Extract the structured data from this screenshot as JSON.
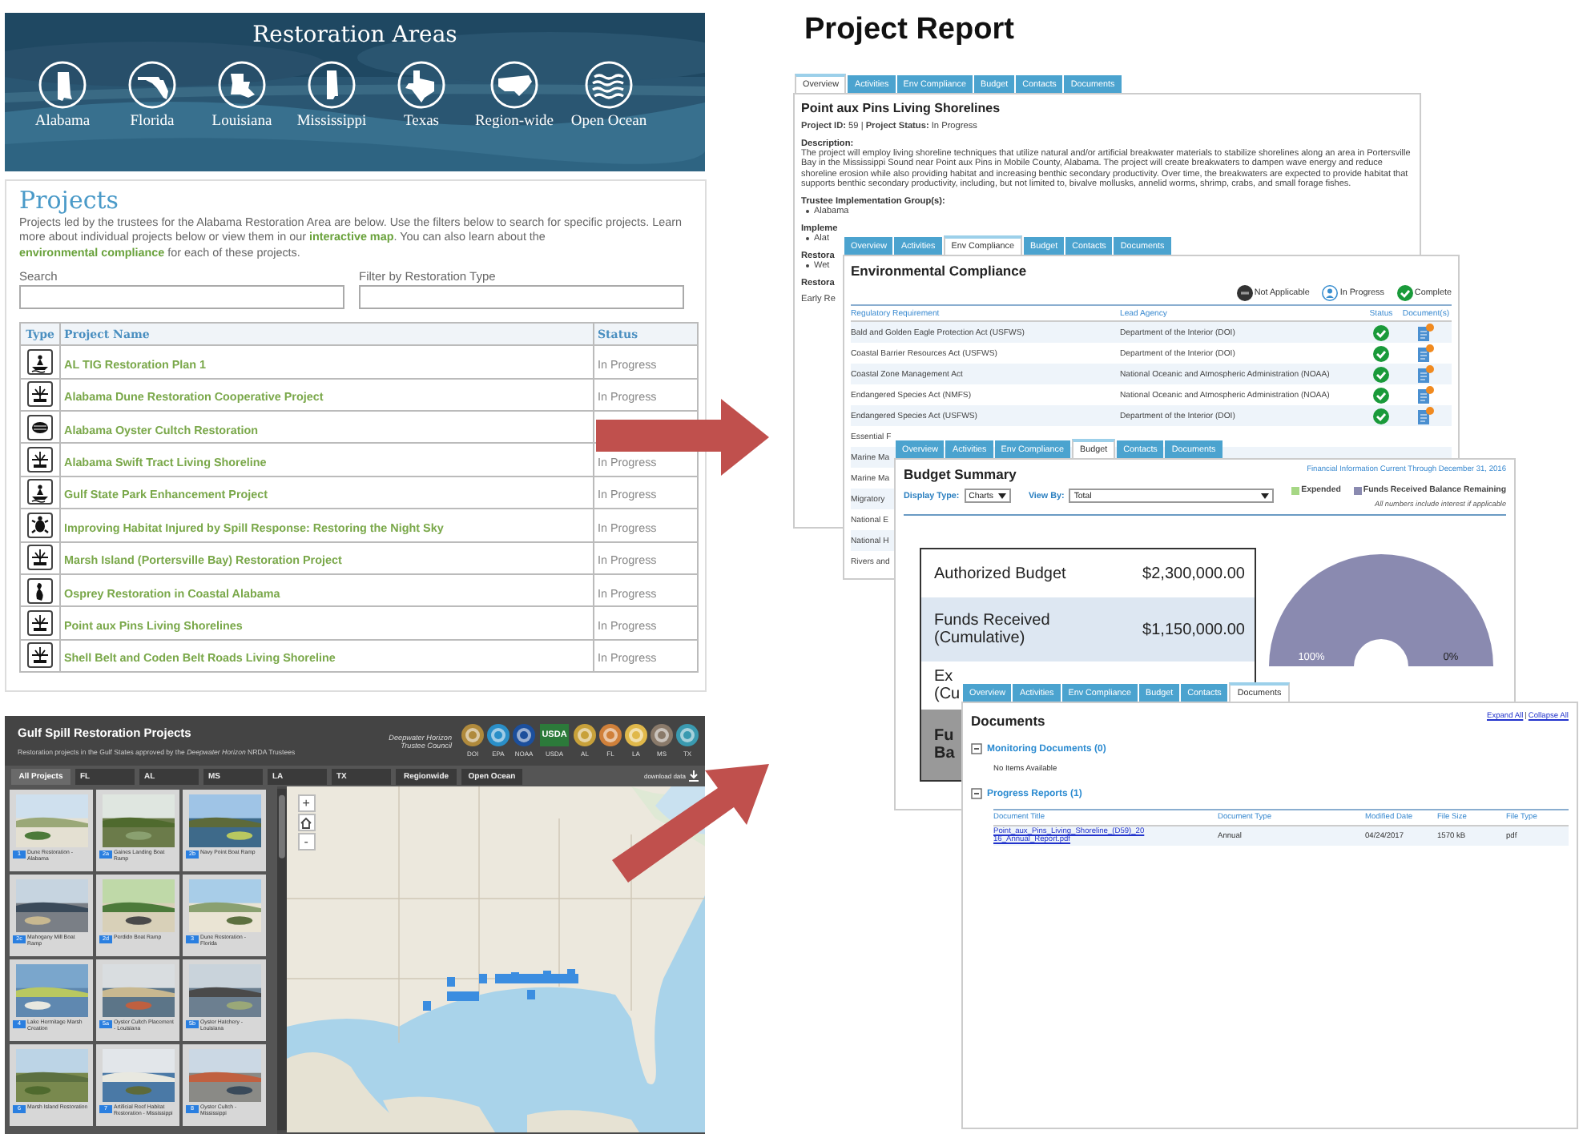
{
  "restoration_areas": {
    "title": "Restoration Areas",
    "areas": [
      {
        "label": "Alabama",
        "kind": "al"
      },
      {
        "label": "Florida",
        "kind": "fl"
      },
      {
        "label": "Louisiana",
        "kind": "la"
      },
      {
        "label": "Mississippi",
        "kind": "ms"
      },
      {
        "label": "Texas",
        "kind": "tx"
      },
      {
        "label": "Region-wide",
        "kind": "us"
      },
      {
        "label": "Open Ocean",
        "kind": "ocean"
      }
    ]
  },
  "projects": {
    "title": "Projects",
    "intro": [
      {
        "kind": "text",
        "text": "Projects led by the trustees for the Alabama Restoration Area are below. Use the filters below to search for specific projects. Learn more about individual projects below or view them in our "
      },
      {
        "kind": "link",
        "text": "interactive map"
      },
      {
        "kind": "text",
        "text": ". You can also learn about the "
      },
      {
        "kind": "link",
        "text": "environmental compliance"
      },
      {
        "kind": "text",
        "text": " for each of these projects."
      }
    ],
    "search_label": "Search",
    "filter_label": "Filter by Restoration Type",
    "columns": [
      "Type",
      "Project Name",
      "Status"
    ],
    "rows": [
      {
        "kind": "boat",
        "name": "AL TIG Restoration Plan 1",
        "status": "In Progress"
      },
      {
        "kind": "marsh",
        "name": "Alabama Dune Restoration Cooperative Project",
        "status": "In Progress"
      },
      {
        "kind": "oyster",
        "name": "Alabama Oyster Cultch Restoration"
      },
      {
        "kind": "marsh",
        "name": "Alabama Swift Tract Living Shoreline",
        "status": "In Progress"
      },
      {
        "kind": "boat",
        "name": "Gulf State Park Enhancement Project",
        "status": "In Progress"
      },
      {
        "kind": "turtle",
        "name": "Improving Habitat Injured by Spill Response: Restoring the Night Sky",
        "status": "In Progress"
      },
      {
        "kind": "marsh",
        "name": "Marsh Island (Portersville Bay) Restoration Project",
        "status": "In Progress"
      },
      {
        "kind": "bird",
        "name": "Osprey Restoration in Coastal Alabama",
        "status": "In Progress"
      },
      {
        "kind": "marsh",
        "name": "Point aux Pins Living Shorelines",
        "status": "In Progress"
      },
      {
        "kind": "marsh",
        "name": "Shell Belt and Coden Belt Roads Living Shoreline",
        "status": "In Progress"
      }
    ]
  },
  "map_app": {
    "title": "Gulf Spill Restoration Projects",
    "subtitle": "Restoration projects in the Gulf States approved by the *Deepwater Horizon* NRDA Trustees",
    "council": "Deepwater Horizon Trustee Council",
    "logos": [
      {
        "label": "DOI",
        "kind": "seal",
        "color": "#b08a3c"
      },
      {
        "label": "EPA",
        "kind": "seal",
        "color": "#2a8fc8"
      },
      {
        "label": "NOAA",
        "kind": "seal",
        "color": "#1c4f9c"
      },
      {
        "label": "USDA",
        "kind": "wordmark",
        "color": "#2c7a3a",
        "text": "USDA"
      },
      {
        "label": "AL",
        "kind": "seal",
        "color": "#c8a13a"
      },
      {
        "label": "FL",
        "kind": "seal",
        "color": "#d0803a"
      },
      {
        "label": "LA",
        "kind": "seal",
        "color": "#e0b84a"
      },
      {
        "label": "MS",
        "kind": "seal",
        "color": "#8a7a6a"
      },
      {
        "label": "TX",
        "kind": "seal",
        "color": "#3a9ab0"
      }
    ],
    "tabs": [
      {
        "label": "All Projects",
        "selected": true
      },
      {
        "label": "FL",
        "selected": false
      },
      {
        "label": "AL",
        "selected": false
      },
      {
        "label": "MS",
        "selected": false
      },
      {
        "label": "LA",
        "selected": false
      },
      {
        "label": "TX",
        "selected": false
      },
      {
        "label": "Regionwide",
        "selected": false
      },
      {
        "label": "Open Ocean",
        "selected": false
      }
    ],
    "download": "download data",
    "projects": [
      {
        "number": "1",
        "caption": "Dune Restoration - Alabama"
      },
      {
        "number": "2a",
        "caption": "Gaines Landing Boat Ramp"
      },
      {
        "number": "2b",
        "caption": "Navy Point Boat Ramp"
      },
      {
        "number": "2c",
        "caption": "Mahogany Mill Boat Ramp"
      },
      {
        "number": "2d",
        "caption": "Perdido Boat Ramp"
      },
      {
        "number": "3",
        "caption": "Dune Restoration - Florida"
      },
      {
        "number": "4",
        "caption": "Lake Hermitage Marsh Creation"
      },
      {
        "number": "5a",
        "caption": "Oyster Cultch Placement - Louisiana"
      },
      {
        "number": "5b",
        "caption": "Oyster Hatchery - Louisiana"
      },
      {
        "number": "6",
        "caption": "Marsh Island Restoration"
      },
      {
        "number": "7",
        "caption": "Artificial Reef Habitat Restoration - Mississippi"
      },
      {
        "number": "8",
        "caption": "Oyster Cultch - Mississippi"
      }
    ],
    "zoom_in": "+",
    "zoom_out": "-"
  },
  "report_title": "Project Report",
  "overview_card": {
    "tabs": [
      {
        "label": "Overview",
        "selected": true
      },
      {
        "label": "Activities",
        "selected": false
      },
      {
        "label": "Env Compliance",
        "selected": false
      },
      {
        "label": "Budget",
        "selected": false
      },
      {
        "label": "Contacts",
        "selected": false
      },
      {
        "label": "Documents",
        "selected": false
      }
    ],
    "title": "Point aux Pins Living Shorelines",
    "id_line": "**Project ID:** 59 | **Project Status:** In Progress",
    "description_label": "Description:",
    "description": "The project will employ living shoreline techniques that utilize natural and/or artificial breakwater materials to stabilize shorelines along an area in Portersville Bay in the Mississippi Sound near Point aux Pins in Mobile County, Alabama. The project will create breakwaters to dampen wave energy and reduce shoreline erosion while also providing habitat and increasing benthic secondary productivity. Over time, the breakwaters are expected to provide habitat that supports benthic secondary productivity, including, but not limited to, bivalve mollusks, annelid worms, shrimp, crabs, and small forage fishes.",
    "sections": [
      {
        "heading": "Trustee Implementation Group(s):",
        "items": [
          "Alabama"
        ]
      },
      {
        "heading": "Impleme",
        "items": [
          "Alat"
        ]
      },
      {
        "heading": "Restora",
        "items": [
          "Wet"
        ]
      },
      {
        "heading": "Restora",
        "text": "Early Re"
      }
    ]
  },
  "compliance_card": {
    "tabs": [
      {
        "label": "Overview",
        "selected": false
      },
      {
        "label": "Activities",
        "selected": false
      },
      {
        "label": "Env Compliance",
        "selected": true
      },
      {
        "label": "Budget",
        "selected": false
      },
      {
        "label": "Contacts",
        "selected": false
      },
      {
        "label": "Documents",
        "selected": false
      }
    ],
    "title": "Environmental Compliance",
    "legend": [
      {
        "label": "Not Applicable",
        "kind": "na"
      },
      {
        "label": "In Progress",
        "kind": "progress"
      },
      {
        "label": "Complete",
        "kind": "complete"
      }
    ],
    "columns": [
      "Regulatory Requirement",
      "Lead Agency",
      "Status",
      "Document(s)"
    ],
    "rows": [
      {
        "requirement": "Bald and Golden Eagle Protection Act (USFWS)",
        "agency": "Department of the Interior (DOI)",
        "complete": true,
        "document": true
      },
      {
        "requirement": "Coastal Barrier Resources Act (USFWS)",
        "agency": "Department of the Interior (DOI)",
        "complete": true,
        "document": true
      },
      {
        "requirement": "Coastal Zone Management Act",
        "agency": "National Oceanic and Atmospheric Administration (NOAA)",
        "complete": true,
        "document": true
      },
      {
        "requirement": "Endangered Species Act (NMFS)",
        "agency": "National Oceanic and Atmospheric Administration (NOAA)",
        "complete": true,
        "document": true
      },
      {
        "requirement": "Endangered Species Act (USFWS)",
        "agency": "Department of the Interior (DOI)",
        "complete": true,
        "document": true
      },
      {
        "requirement": "Essential F"
      },
      {
        "requirement": "Marine Ma"
      },
      {
        "requirement": "Marine Ma"
      },
      {
        "requirement": "Migratory"
      },
      {
        "requirement": "National E"
      },
      {
        "requirement": "National H"
      },
      {
        "requirement": "Rivers and"
      }
    ]
  },
  "budget_card": {
    "tabs": [
      {
        "label": "Overview",
        "selected": false
      },
      {
        "label": "Activities",
        "selected": false
      },
      {
        "label": "Env Compliance",
        "selected": false
      },
      {
        "label": "Budget",
        "selected": true
      },
      {
        "label": "Contacts",
        "selected": false
      },
      {
        "label": "Documents",
        "selected": false
      }
    ],
    "note": "Financial Information Current Through December 31, 2016",
    "title": "Budget Summary",
    "display_type_label": "Display Type:",
    "display_type": "Charts",
    "view_by_label": "View By:",
    "view_by": "Total",
    "legend": [
      {
        "color": "#a6d785"
      },
      {
        "color": "#8a8ab0"
      }
    ],
    "legend_note": "All numbers include interest if applicable",
    "summary": [
      {
        "label": "Authorized Budget",
        "amount": "$2,300,000.00",
        "kind": "plain"
      },
      {
        "label": "Funds Received\n(Cumulative)",
        "amount": "$1,150,000.00",
        "kind": "highlight"
      },
      {
        "label": "Ex\n(Cu",
        "kind": "plain"
      },
      {
        "label": "Fu\nBa",
        "kind": "total"
      }
    ],
    "chart_data": {
      "type": "pie",
      "categories": [
        "Expended",
        "Funds Received Balance Remaining"
      ],
      "values": [
        0,
        100
      ],
      "value_labels": [
        "0%",
        "100%"
      ]
    }
  },
  "documents_card": {
    "tabs": [
      {
        "label": "Overview",
        "selected": false
      },
      {
        "label": "Activities",
        "selected": false
      },
      {
        "label": "Env Compliance",
        "selected": false
      },
      {
        "label": "Budget",
        "selected": false
      },
      {
        "label": "Contacts",
        "selected": false
      },
      {
        "label": "Documents",
        "selected": true
      }
    ],
    "title": "Documents",
    "expand_all": "Expand All",
    "separator": "|",
    "collapse_all": "Collapse All",
    "sections": [
      {
        "title": "Monitoring Documents (0)",
        "expanded": true,
        "empty": "No Items Available"
      },
      {
        "title": "Progress Reports (1)",
        "expanded": true,
        "columns": [
          "Document Title",
          "Document Type",
          "Modified Date",
          "File Size",
          "File Type"
        ],
        "rows": [
          {
            "title": "Point_aux_Pins_Living_Shoreline_(D59)_2016_Annual_Report.pdf",
            "type": "Annual",
            "modified": "04/24/2017",
            "size": "1570 kB",
            "file_type": "pdf"
          }
        ]
      }
    ]
  }
}
